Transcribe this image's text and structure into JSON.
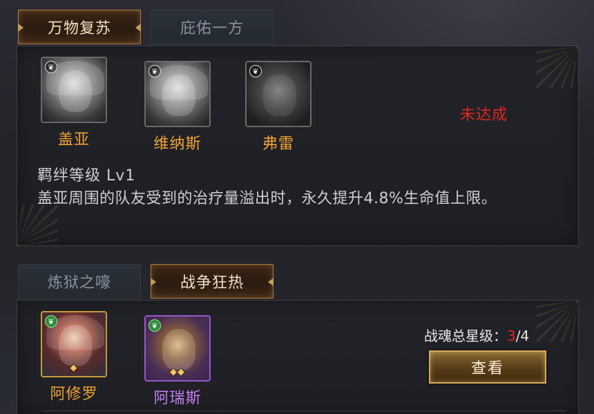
{
  "section1": {
    "tabs": [
      {
        "label": "万物复苏",
        "active": true
      },
      {
        "label": "庇佑一方",
        "active": false
      }
    ],
    "heroes": [
      {
        "name": "盖亚",
        "element": "leaf",
        "style": "gray"
      },
      {
        "name": "维纳斯",
        "element": "leaf",
        "style": "gray"
      },
      {
        "name": "弗雷",
        "element": "leaf",
        "style": "dark"
      }
    ],
    "status": "未达成",
    "bond_level": "羁绊等级 Lv1",
    "description": "盖亚周围的队友受到的治疗量溢出时，永久提升4.8%生命值上限。"
  },
  "section2": {
    "tabs": [
      {
        "label": "炼狱之嚎",
        "active": false
      },
      {
        "label": "战争狂热",
        "active": true
      }
    ],
    "heroes": [
      {
        "name": "阿修罗",
        "element": "leaf",
        "stars": "◆",
        "rarity": "gold"
      },
      {
        "name": "阿瑞斯",
        "element": "leaf",
        "stars": "◆◆",
        "rarity": "purple"
      }
    ],
    "star_total_label": "战魂总星级：",
    "star_current": "3",
    "star_max": "/4",
    "view_button": "查看"
  },
  "colors": {
    "accent_gold": "#c69a5a",
    "status_red": "#e0261e",
    "name_orange": "#f0a236",
    "name_purple": "#c57ef0"
  }
}
